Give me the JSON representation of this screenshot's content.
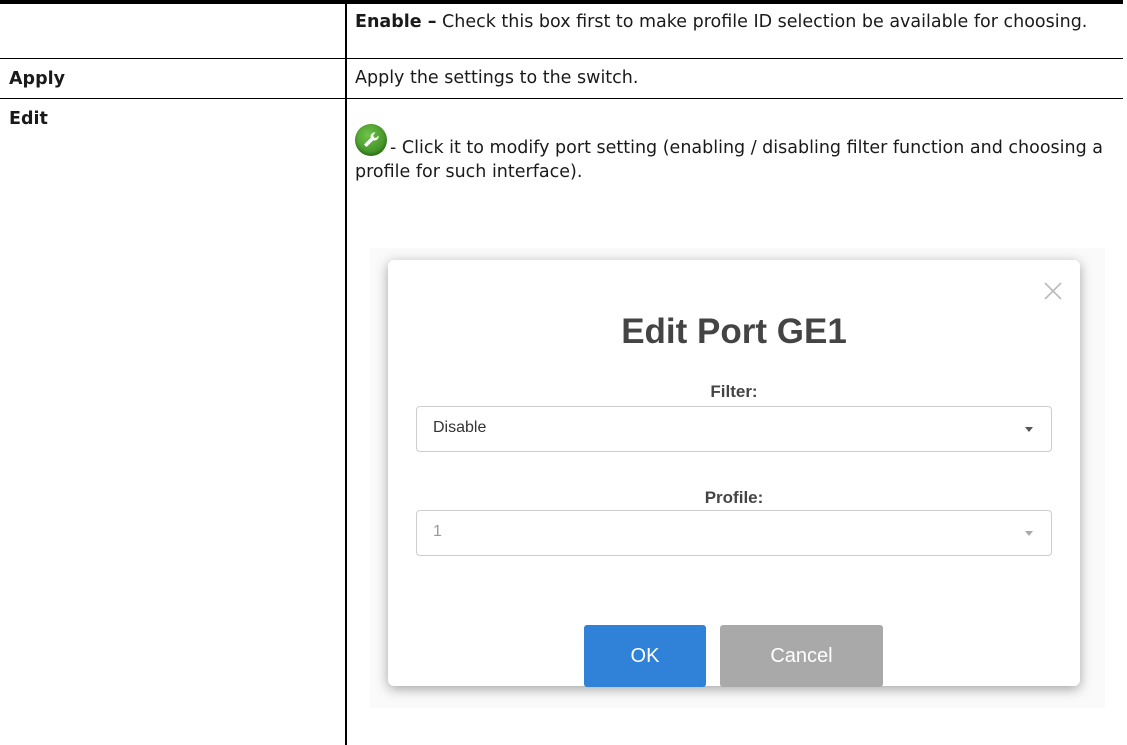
{
  "rows": [
    {
      "term": "",
      "desc_bold": "Enable –",
      "desc_text": " Check this box first to make profile ID selection be available for choosing."
    },
    {
      "term": "Apply",
      "desc_text": "Apply the settings to the switch."
    },
    {
      "term": "Edit",
      "desc_text": " - Click it to modify port setting (enabling / disabling filter function and choosing a profile for such interface)."
    }
  ],
  "modal": {
    "title": "Edit Port GE1",
    "filter_label": "Filter:",
    "filter_value": "Disable",
    "profile_label": "Profile:",
    "profile_value": "1",
    "ok_label": "OK",
    "cancel_label": "Cancel"
  },
  "icons": {
    "edit": "wrench-icon",
    "close": "close-icon"
  },
  "colors": {
    "wrench_green": "#4a9d2b",
    "ok_blue": "#2f82d8",
    "cancel_gray": "#a9a9a9"
  }
}
